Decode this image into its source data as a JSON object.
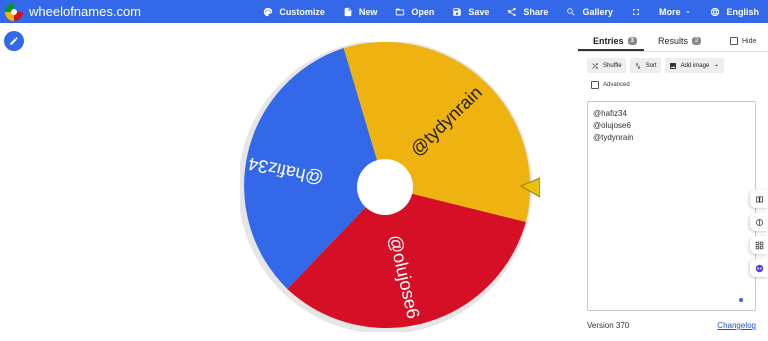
{
  "header": {
    "brand": "wheelofnames.com",
    "menu": {
      "customize": "Customize",
      "new": "New",
      "open": "Open",
      "save": "Save",
      "share": "Share",
      "gallery": "Gallery",
      "more": "More",
      "language": "English"
    }
  },
  "colors": {
    "topbar": "#3369e8",
    "blue": "#3369e8",
    "red": "#d50f25",
    "yellow": "#eeb211",
    "pointer": "#e8c20d"
  },
  "wheel": {
    "segments": [
      {
        "label": "@hafiz34",
        "color": "#3369e8"
      },
      {
        "label": "@olujose6",
        "color": "#d50f25"
      },
      {
        "label": "@tydynrain",
        "color": "#eeb211"
      }
    ]
  },
  "panel": {
    "tabs": {
      "entries_label": "Entries",
      "entries_count": "3",
      "results_label": "Results",
      "results_count": "2"
    },
    "hide_label": "Hide",
    "tools": {
      "shuffle": "Shuffle",
      "sort": "Sort",
      "add_image": "Add image"
    },
    "advanced_label": "Advanced",
    "entries": [
      "@hafiz34",
      "@olujose6",
      "@tydynrain"
    ],
    "version": "Version 370",
    "changelog": "Changelog"
  }
}
